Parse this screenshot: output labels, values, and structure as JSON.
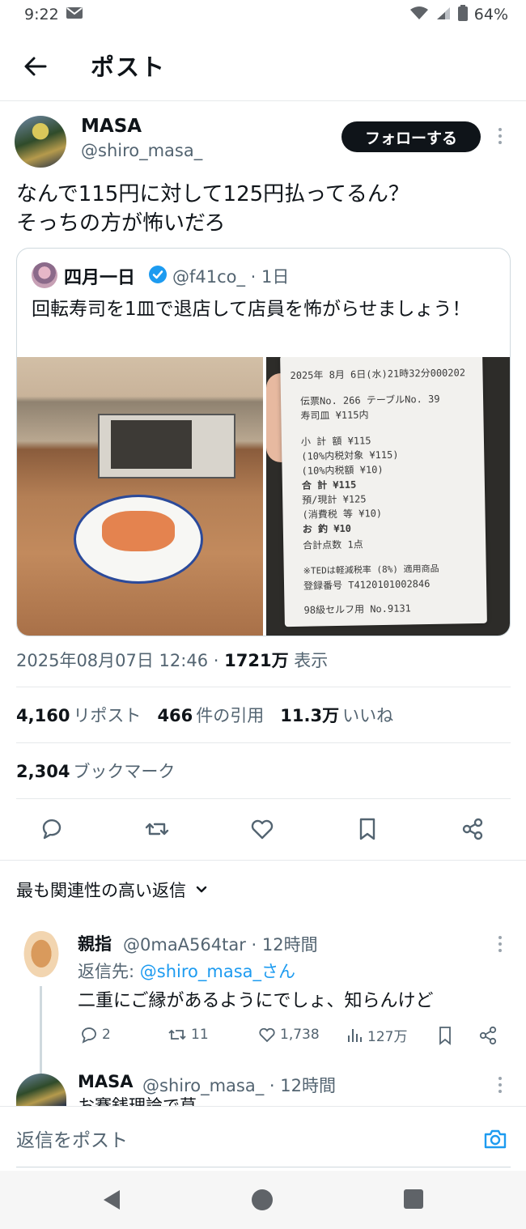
{
  "status_bar": {
    "time": "9:22",
    "battery": "64%"
  },
  "header": {
    "title": "ポスト"
  },
  "post": {
    "author_name": "MASA",
    "author_handle": "@shiro_masa_",
    "follow_label": "フォローする",
    "text": "なんで115円に対して125円払ってるん？\nそっちの方が怖いだろ",
    "quote": {
      "name": "四月一日",
      "handle_time": "@f41co_ · 1日",
      "text": "回転寿司を1皿で退店して店員を怖がらせましょう！",
      "receipt": {
        "line1": "2025年 8月 6日(水)21時32分000202",
        "line2": "伝票No.  266  テーブルNo.  39",
        "line3": "寿司皿              ¥115内",
        "line4": "小 計 額              ¥115",
        "line5": "(10%内税対象          ¥115)",
        "line6": "(10%内税額             ¥10)",
        "line7": "合    計             ¥115",
        "line8": "預/現計              ¥125",
        "line9": "  (消費税 等           ¥10)",
        "line10": "お  釣               ¥10",
        "line11": "合計点数               1点",
        "line12": "※TEDは軽減税率 (8%) 適用商品",
        "line13": "登録番号  T4120101002846",
        "line14": "98級セルフ用    No.9131"
      }
    },
    "timestamp": "2025年08月07日 12:46 ·",
    "views_count": "1721万",
    "views_label": "表示",
    "stats": {
      "reposts": "4,160",
      "reposts_label": "リポスト",
      "quotes": "466",
      "quotes_label": "件の引用",
      "likes": "11.3万",
      "likes_label": "いいね",
      "bookmarks": "2,304",
      "bookmarks_label": "ブックマーク"
    }
  },
  "replies_sort": {
    "label": "最も関連性の高い返信"
  },
  "reply": {
    "name": "親指",
    "handle_time": "@0maA564tar · 12時間",
    "reply_to_prefix": "返信先: ",
    "reply_to_handle": "@shiro_masa_さん",
    "text": "二重にご縁があるようにでしょ、知らんけど",
    "comments": "2",
    "reposts": "11",
    "likes": "1,738",
    "views": "127万"
  },
  "reply2": {
    "name": "MASA",
    "handle_time": "@shiro_masa_ · 12時間",
    "text": "お賽銭理論で草"
  },
  "composer": {
    "placeholder": "返信をポスト"
  },
  "colors": {
    "link": "#1d9bf0",
    "muted": "#536471",
    "text": "#0f1419"
  }
}
